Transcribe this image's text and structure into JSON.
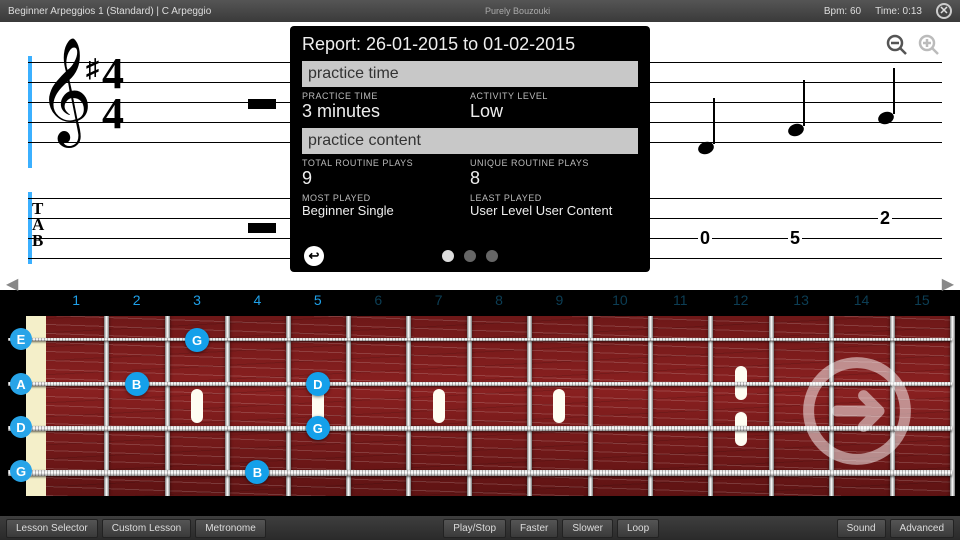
{
  "topbar": {
    "title": "Beginner Arpeggios 1 (Standard)  |  C Arpeggio",
    "brand": "Purely Bouzouki",
    "bpm_label": "Bpm:",
    "bpm_value": "60",
    "time_label": "Time:",
    "time_value": "0:13"
  },
  "report": {
    "title": "Report:  26-01-2015  to  01-02-2015",
    "section1": "practice time",
    "practice_time_label": "PRACTICE TIME",
    "practice_time_value": "3 minutes",
    "activity_level_label": "ACTIVITY LEVEL",
    "activity_level_value": "Low",
    "section2": "practice content",
    "total_plays_label": "TOTAL ROUTINE PLAYS",
    "total_plays_value": "9",
    "unique_plays_label": "UNIQUE ROUTINE PLAYS",
    "unique_plays_value": "8",
    "most_played_label": "MOST PLAYED",
    "most_played_value": "Beginner Single",
    "least_played_label": "LEAST PLAYED",
    "least_played_value": "User Level User Content"
  },
  "notation": {
    "time_sig_top": "4",
    "time_sig_bottom": "4",
    "tab_letters": [
      "T",
      "A",
      "B"
    ],
    "tab_numbers": [
      "0",
      "5",
      "2"
    ]
  },
  "fretnums": [
    "1",
    "2",
    "3",
    "4",
    "5",
    "6",
    "7",
    "8",
    "9",
    "10",
    "11",
    "12",
    "13",
    "14",
    "15"
  ],
  "open_strings": [
    "E",
    "A",
    "D",
    "G"
  ],
  "fretboard_markers": [
    {
      "fret": 3,
      "string": 1,
      "note": "G"
    },
    {
      "fret": 2,
      "string": 2,
      "note": "B"
    },
    {
      "fret": 5,
      "string": 2,
      "note": "D"
    },
    {
      "fret": 5,
      "string": 3,
      "note": "G"
    },
    {
      "fret": 4,
      "string": 4,
      "note": "B"
    }
  ],
  "bottombar": {
    "lesson_selector": "Lesson Selector",
    "custom_lesson": "Custom Lesson",
    "metronome": "Metronome",
    "play_stop": "Play/Stop",
    "faster": "Faster",
    "slower": "Slower",
    "loop": "Loop",
    "sound": "Sound",
    "advanced": "Advanced"
  }
}
